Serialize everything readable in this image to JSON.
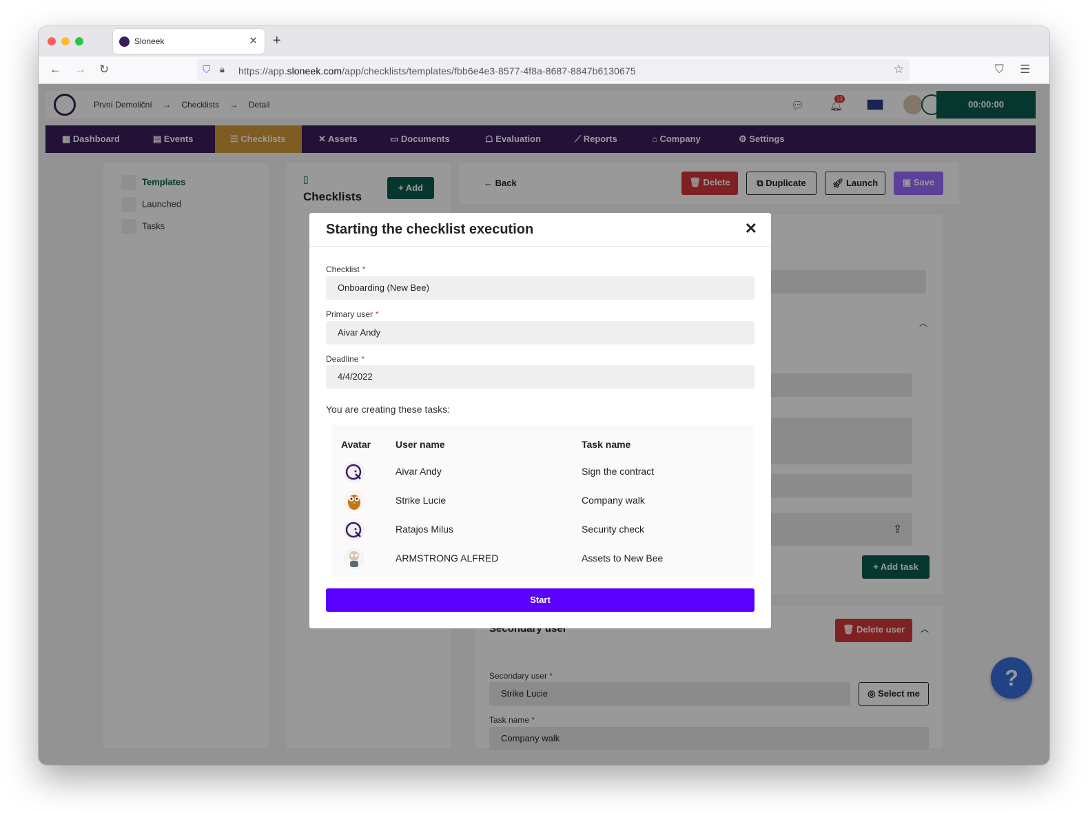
{
  "browser": {
    "tab_title": "Sloneek",
    "url_prefix": "https://app.",
    "url_domain": "sloneek.com",
    "url_path": "/app/checklists/templates/fbb6e4e3-8577-4f8a-8687-8847b6130675"
  },
  "topbar": {
    "breadcrumbs": [
      "První Demoliční",
      "→",
      "Checklists",
      "→",
      "Detail"
    ],
    "notification_count": "13",
    "timer": "00:00:00"
  },
  "mainnav": {
    "items": [
      "Dashboard",
      "Events",
      "Checklists",
      "Assets",
      "Documents",
      "Evaluation",
      "Reports",
      "Company",
      "Settings"
    ],
    "active": "Checklists"
  },
  "sidebar": {
    "items": [
      "Templates",
      "Launched",
      "Tasks"
    ]
  },
  "list": {
    "title": "Checklists",
    "add_label": "+ Add"
  },
  "detail": {
    "back_label": "← Back",
    "delete_label": "Delete",
    "duplicate_label": "Duplicate",
    "launch_label": "Launch",
    "save_label": "Save",
    "add_task_label": "+ Add task",
    "secondary_user_heading": "Secondary user",
    "delete_user_label": "Delete user",
    "secondary_user_label": "Secondary user",
    "secondary_user_value": "Strike Lucie",
    "select_me_label": "Select me",
    "task_name_label": "Task name",
    "task_name_value": "Company walk",
    "required_mark": "*"
  },
  "help": {
    "label": "?"
  },
  "modal": {
    "title": "Starting the checklist execution",
    "close_label": "✕",
    "checklist_label": "Checklist",
    "checklist_value": "Onboarding (New Bee)",
    "primary_user_label": "Primary user",
    "primary_user_value": "Aivar Andy",
    "deadline_label": "Deadline",
    "deadline_value": "4/4/2022",
    "required_mark": "*",
    "intro": "You are creating these tasks:",
    "columns": [
      "Avatar",
      "User name",
      "Task name"
    ],
    "rows": [
      {
        "user": "Aivar Andy",
        "task": "Sign the contract",
        "avatar": "sloneek-logo"
      },
      {
        "user": "Strike Lucie",
        "task": "Company walk",
        "avatar": "owl"
      },
      {
        "user": "Ratajos Milus",
        "task": "Security check",
        "avatar": "sloneek-logo"
      },
      {
        "user": "ARMSTRONG ALFRED",
        "task": "Assets to New Bee",
        "avatar": "astronaut"
      }
    ],
    "start_label": "Start"
  },
  "colors": {
    "brand_purple": "#3b1d5e",
    "active_nav": "#d49a3a",
    "green": "#0a5c4e",
    "red": "#d63838",
    "start_button": "#5a00ff"
  }
}
